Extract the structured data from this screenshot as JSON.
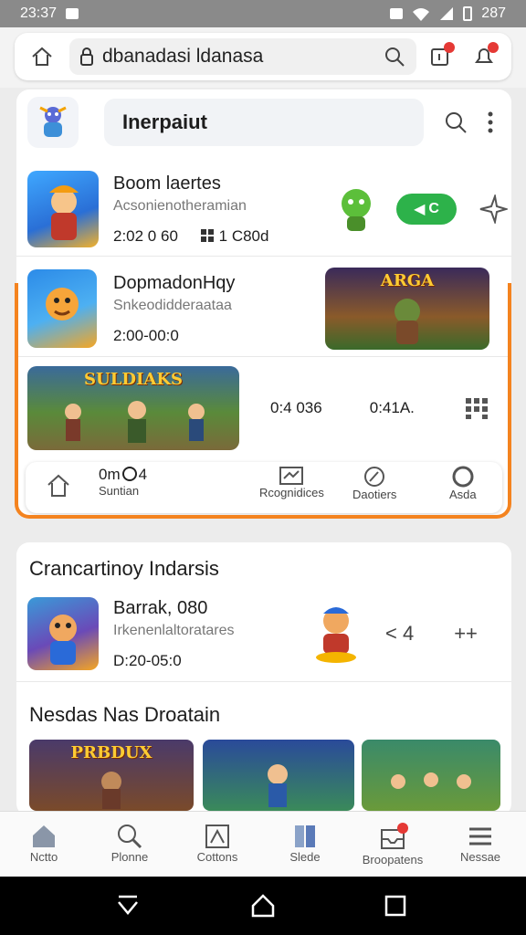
{
  "status": {
    "time": "23:37",
    "battery": "287"
  },
  "browser": {
    "url": "dbanadasi ldanasa"
  },
  "header": {
    "search_text": "Inerpaiut"
  },
  "featured": [
    {
      "title": "Boom laertes",
      "subtitle": "Acsonienotheramian",
      "meta_left": "2:02 0 60",
      "meta_right": "1 C80d",
      "action": "C"
    },
    {
      "title": "DopmadonHqy",
      "subtitle": "Snkeodidderaataa",
      "meta_left": "2:00-00:0"
    },
    {
      "value_a": "0:4 036",
      "value_b": "0:41A."
    }
  ],
  "inner_nav": {
    "home_counter": "0m",
    "home_counter_num": "4",
    "home_label": "Suntian",
    "items": [
      "Rcognidices",
      "Daotiers",
      "Asda"
    ]
  },
  "section2": {
    "title": "Crancartinoy Indarsis",
    "item": {
      "title": "Barrak, 080",
      "subtitle": "Irkenenlaltoratares",
      "meta": "D:20-05:0",
      "action": "< 4",
      "action_alt": "++"
    }
  },
  "section3": {
    "title": "Nesdas Nas Droatain",
    "banners": [
      "PRBDUX",
      "",
      ""
    ]
  },
  "bottom_nav": [
    "Nctto",
    "Plonne",
    "Cottons",
    "Slede",
    "Broopatens",
    "Nessae"
  ],
  "colors": {
    "accent": "#f4831f",
    "play": "#2db24a",
    "badge": "#e53935"
  }
}
